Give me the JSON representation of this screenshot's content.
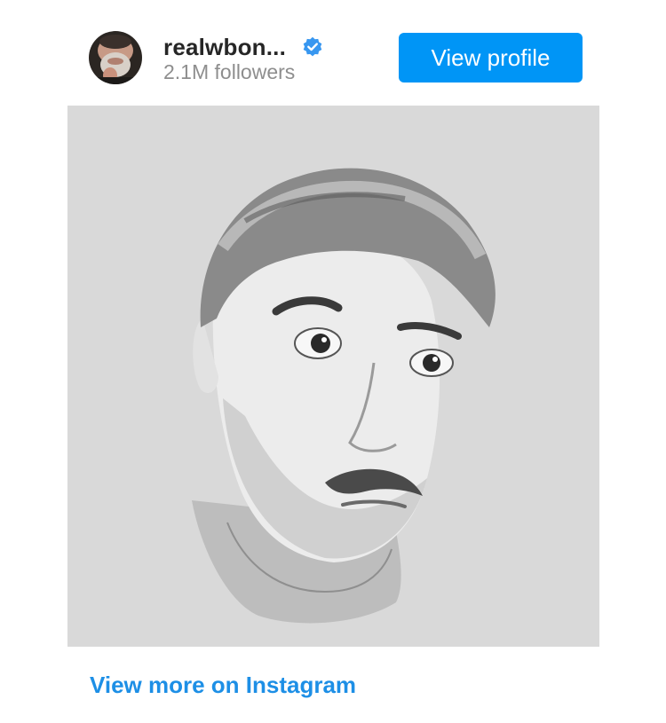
{
  "header": {
    "username": "realwbon...",
    "followers": "2.1M followers",
    "verified": true,
    "avatar_icon": "profile-photo-avatar",
    "verified_icon": "verified-badge-icon"
  },
  "actions": {
    "view_profile_label": "View profile",
    "view_more_label": "View more on Instagram"
  },
  "colors": {
    "accent": "#0095f6",
    "link": "#1d8fe6",
    "username": "#262626",
    "secondary_text": "#8e8e8e",
    "photo_background": "#d9d9d9"
  }
}
